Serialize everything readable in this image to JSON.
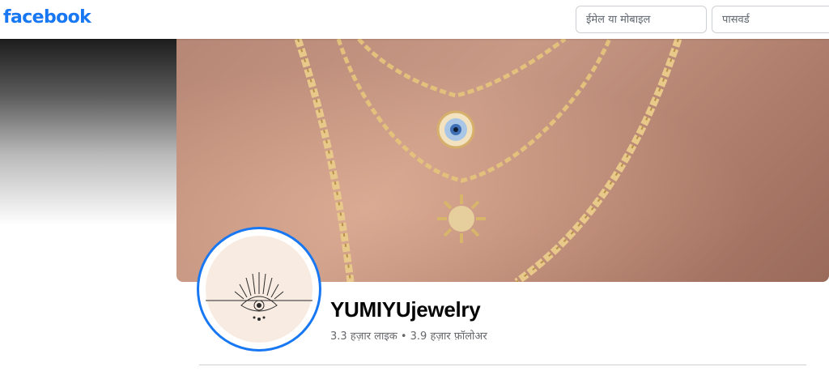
{
  "header": {
    "logo": "facebook",
    "email_placeholder": "ईमेल या मोबाइल",
    "password_placeholder": "पासवर्ड"
  },
  "page": {
    "name": "YUMIYUjewelry",
    "stats": "3.3 हज़ार लाइक • 3.9 हज़ार फ़ॉलोअर"
  },
  "colors": {
    "brand": "#1877f2",
    "avatar_ring": "#1877f2"
  },
  "icons": {
    "logo": "facebook-wordmark",
    "avatar": "evil-eye-sunburst-logo"
  }
}
